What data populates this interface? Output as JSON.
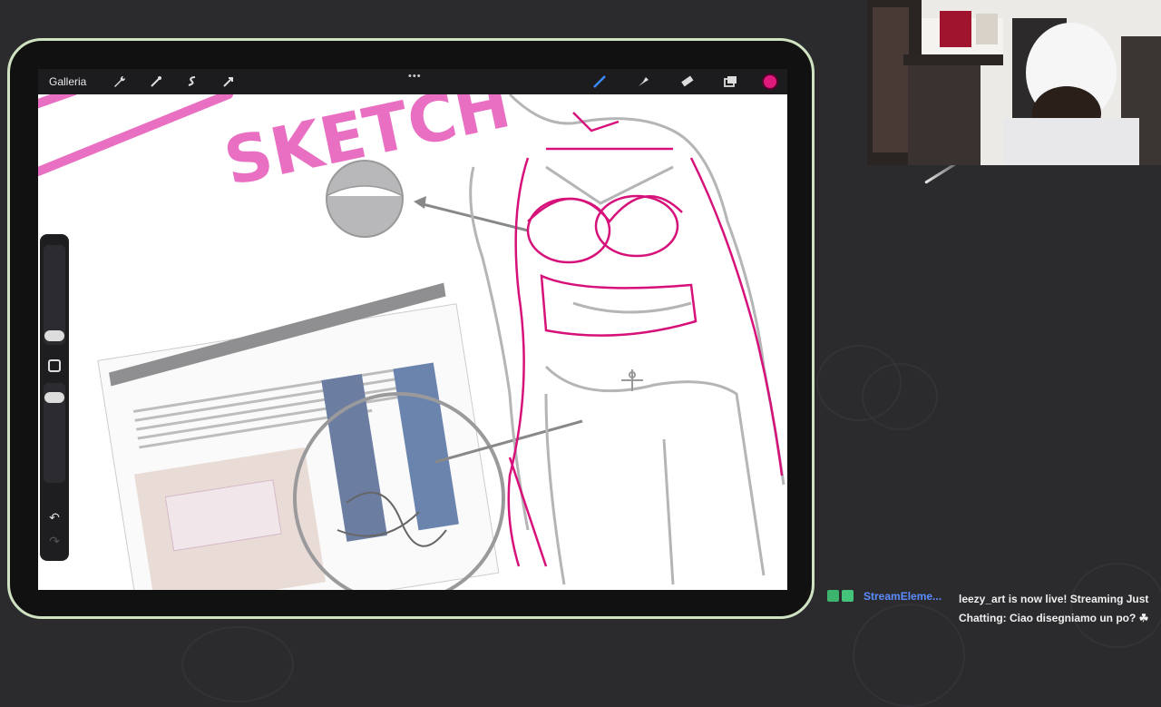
{
  "procreate": {
    "gallery_label": "Galleria",
    "active_color": "#e0197d",
    "top_grip": "•••",
    "sketch_heading": "SKETCH"
  },
  "chat": {
    "username": "StreamEleme...",
    "message": "leezy_art is now live! Streaming Just Chatting: Ciao disegniamo un po? ☘",
    "user_color": "#5b8cff"
  },
  "colors": {
    "tablet_bezel_outline": "#cfe3c2",
    "background": "#2b2b2e",
    "sketch_pink": "#e86fc1",
    "sketch_magenta": "#d6117a"
  }
}
